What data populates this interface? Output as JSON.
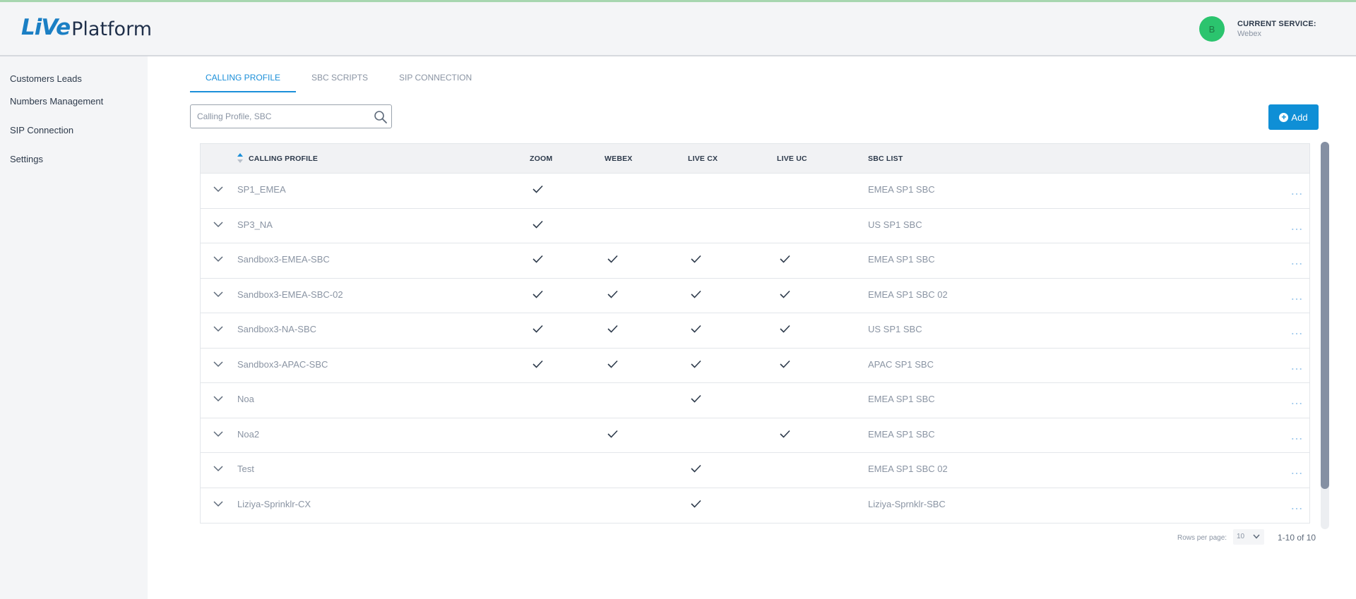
{
  "header": {
    "logo_live": "LiVe",
    "logo_platform": "Platform",
    "avatar_initial": "B",
    "current_service_label": "CURRENT SERVICE:",
    "current_service_value": "Webex"
  },
  "sidebar": {
    "items": [
      {
        "label": "Customers Leads"
      },
      {
        "label": "Numbers Management"
      },
      {
        "label": "SIP Connection"
      },
      {
        "label": "Settings"
      }
    ]
  },
  "tabs": [
    {
      "label": "CALLING PROFILE",
      "active": true
    },
    {
      "label": "SBC SCRIPTS",
      "active": false
    },
    {
      "label": "SIP CONNECTION",
      "active": false
    }
  ],
  "search": {
    "placeholder": "Calling Profile, SBC",
    "value": ""
  },
  "toolbar": {
    "add_label": "Add"
  },
  "table": {
    "columns": {
      "calling_profile": "CALLING PROFILE",
      "zoom": "ZOOM",
      "webex": "WEBEX",
      "live_cx": "LIVE CX",
      "live_uc": "LIVE UC",
      "sbc_list": "SBC LIST"
    },
    "rows": [
      {
        "name": "SP1_EMEA",
        "zoom": true,
        "webex": false,
        "live_cx": false,
        "live_uc": false,
        "sbc": "EMEA SP1 SBC"
      },
      {
        "name": "SP3_NA",
        "zoom": true,
        "webex": false,
        "live_cx": false,
        "live_uc": false,
        "sbc": "US SP1 SBC"
      },
      {
        "name": "Sandbox3-EMEA-SBC",
        "zoom": true,
        "webex": true,
        "live_cx": true,
        "live_uc": true,
        "sbc": "EMEA SP1 SBC"
      },
      {
        "name": "Sandbox3-EMEA-SBC-02",
        "zoom": true,
        "webex": true,
        "live_cx": true,
        "live_uc": true,
        "sbc": "EMEA SP1 SBC 02"
      },
      {
        "name": "Sandbox3-NA-SBC",
        "zoom": true,
        "webex": true,
        "live_cx": true,
        "live_uc": true,
        "sbc": "US SP1 SBC"
      },
      {
        "name": "Sandbox3-APAC-SBC",
        "zoom": true,
        "webex": true,
        "live_cx": true,
        "live_uc": true,
        "sbc": "APAC SP1 SBC"
      },
      {
        "name": "Noa",
        "zoom": false,
        "webex": false,
        "live_cx": true,
        "live_uc": false,
        "sbc": "EMEA SP1 SBC"
      },
      {
        "name": "Noa2",
        "zoom": false,
        "webex": true,
        "live_cx": false,
        "live_uc": true,
        "sbc": "EMEA SP1 SBC"
      },
      {
        "name": "Test",
        "zoom": false,
        "webex": false,
        "live_cx": true,
        "live_uc": false,
        "sbc": "EMEA SP1 SBC 02"
      },
      {
        "name": "Liziya-Sprinklr-CX",
        "zoom": false,
        "webex": false,
        "live_cx": true,
        "live_uc": false,
        "sbc": "Liziya-Sprnklr-SBC"
      }
    ]
  },
  "pagination": {
    "rows_per_page_label": "Rows per page:",
    "rows_per_page_value": "10",
    "range": "1-10 of 10"
  },
  "colors": {
    "accent": "#1b8fd9",
    "add_button": "#0f8fd6",
    "avatar": "#2bc46e"
  }
}
